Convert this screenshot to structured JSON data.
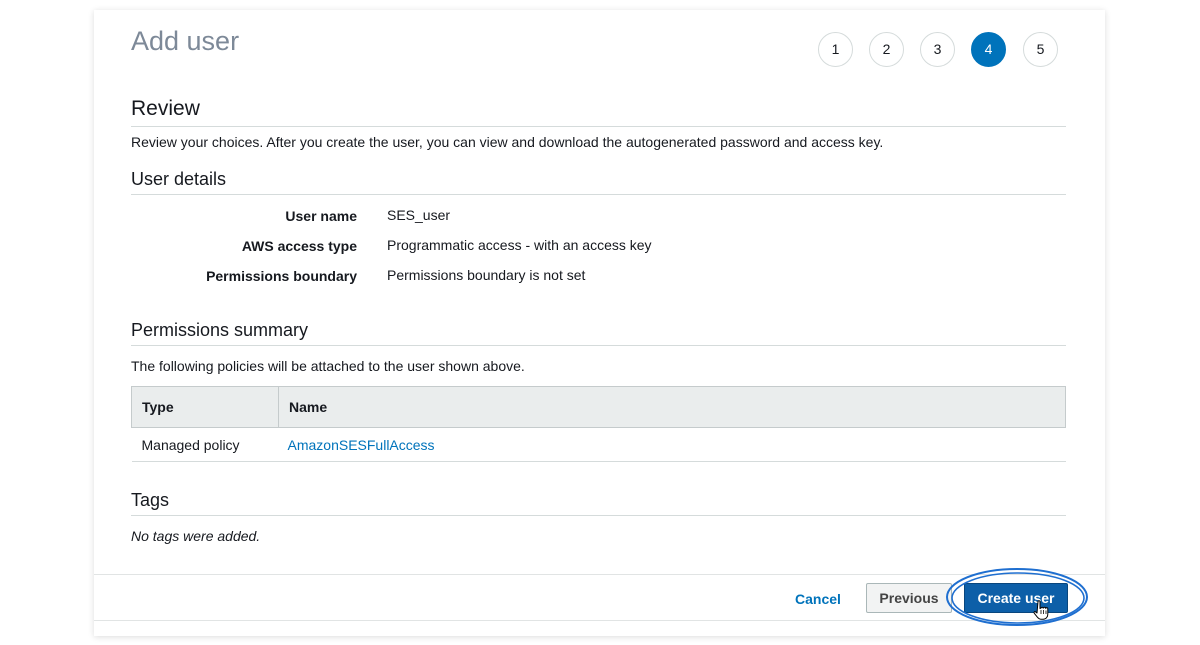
{
  "page": {
    "title": "Add user"
  },
  "steps": [
    "1",
    "2",
    "3",
    "4",
    "5"
  ],
  "active_step": "4",
  "review": {
    "heading": "Review",
    "description": "Review your choices. After you create the user, you can view and download the autogenerated password and access key."
  },
  "user_details": {
    "heading": "User details",
    "rows": [
      {
        "label": "User name",
        "value": "SES_user"
      },
      {
        "label": "AWS access type",
        "value": "Programmatic access - with an access key"
      },
      {
        "label": "Permissions boundary",
        "value": "Permissions boundary is not set"
      }
    ]
  },
  "permissions": {
    "heading": "Permissions summary",
    "description": "The following policies will be attached to the user shown above.",
    "columns": [
      "Type",
      "Name"
    ],
    "rows": [
      {
        "type": "Managed policy",
        "name": "AmazonSESFullAccess"
      }
    ]
  },
  "tags": {
    "heading": "Tags",
    "empty_text": "No tags were added."
  },
  "footer": {
    "cancel_label": "Cancel",
    "previous_label": "Previous",
    "create_label": "Create user"
  },
  "colors": {
    "accent": "#0073bb",
    "primary_button": "#0d5fa8",
    "highlight_ring": "#1f6fd0"
  },
  "icons": {
    "cursor": "hand-pointer-icon"
  }
}
